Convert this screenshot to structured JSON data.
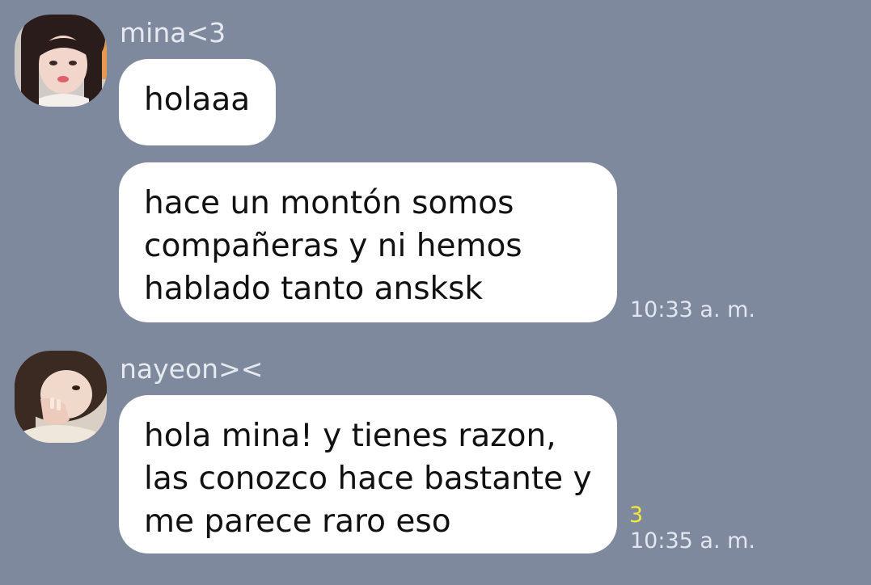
{
  "conversation": {
    "colors": {
      "background": "#7f899d",
      "bubble": "#ffffff",
      "read_count": "#f2e93b"
    },
    "messages": [
      {
        "sender": "mina<3",
        "bubbles": [
          {
            "lines": [
              "holaaa"
            ]
          },
          {
            "lines": [
              "hace un montón somos",
              "compañeras y ni hemos",
              "hablado tanto ansksk"
            ],
            "time": "10:33 a. m."
          }
        ]
      },
      {
        "sender": "nayeon><",
        "bubbles": [
          {
            "lines": [
              "hola mina! y tienes razon,",
              "las conozco hace bastante y",
              "me parece raro eso"
            ],
            "read_count": "3",
            "time": "10:35 a. m."
          }
        ]
      }
    ]
  }
}
